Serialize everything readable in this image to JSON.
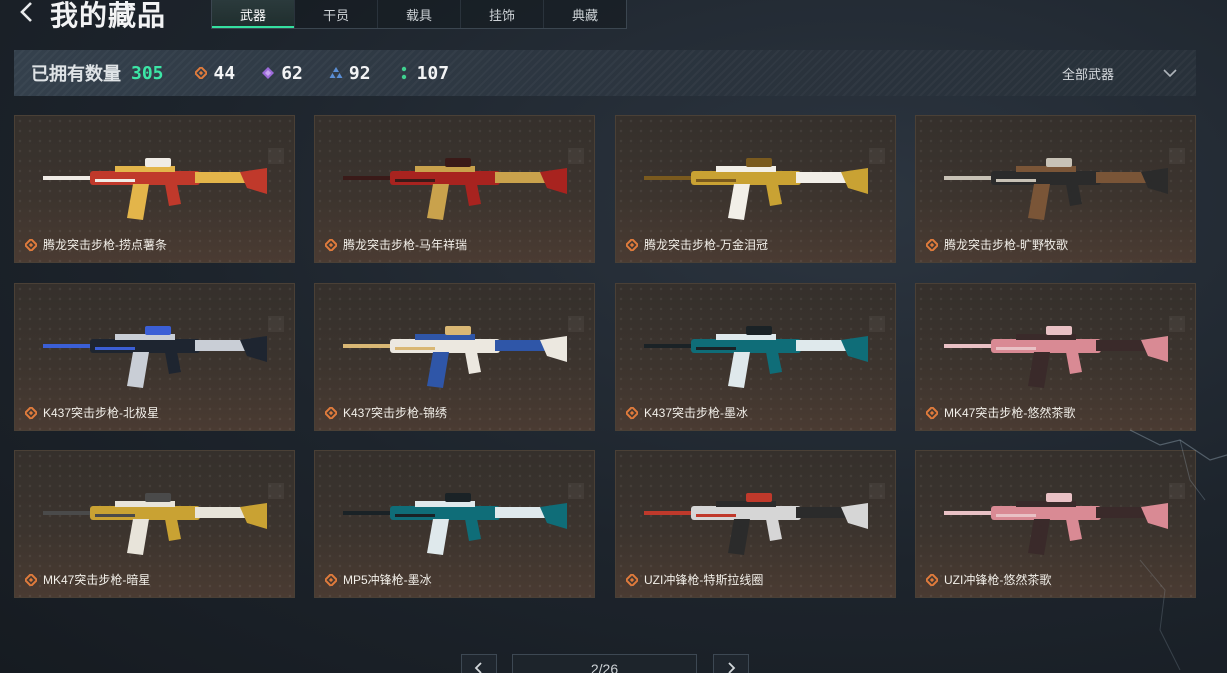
{
  "header": {
    "title": "我的藏品",
    "tabs": [
      {
        "label": "武器",
        "active": true
      },
      {
        "label": "干员",
        "active": false
      },
      {
        "label": "载具",
        "active": false
      },
      {
        "label": "挂饰",
        "active": false
      },
      {
        "label": "典藏",
        "active": false
      }
    ]
  },
  "stats": {
    "owned_label": "已拥有数量",
    "owned_count": "305",
    "rarities": [
      {
        "icon": "orange-diamond-icon",
        "color": "#e07b3c",
        "count": "44"
      },
      {
        "icon": "purple-diamond-icon",
        "color": "#9c6bd9",
        "count": "62"
      },
      {
        "icon": "blue-triangle-icon",
        "color": "#5b8fd6",
        "count": "92"
      },
      {
        "icon": "green-dots-icon",
        "color": "#3fd08f",
        "count": "107"
      }
    ],
    "filter_label": "全部武器"
  },
  "items": [
    {
      "name": "腾龙突击步枪-捞点薯条",
      "palette": [
        "#c0392b",
        "#e3b54a",
        "#f0ece6"
      ]
    },
    {
      "name": "腾龙突击步枪-马年祥瑞",
      "palette": [
        "#a8231f",
        "#c9a24c",
        "#3a1a18"
      ]
    },
    {
      "name": "腾龙突击步枪-万金泪冠",
      "palette": [
        "#c9a233",
        "#f2efe8",
        "#7a5a1e"
      ]
    },
    {
      "name": "腾龙突击步枪-旷野牧歌",
      "palette": [
        "#2b2b2b",
        "#7a5537",
        "#c8c2b6"
      ]
    },
    {
      "name": "K437突击步枪-北极星",
      "palette": [
        "#1e2530",
        "#c9ced6",
        "#3b5fd6"
      ]
    },
    {
      "name": "K437突击步枪-锦绣",
      "palette": [
        "#ece8e0",
        "#2f56a8",
        "#d9b774"
      ]
    },
    {
      "name": "K437突击步枪-墨冰",
      "palette": [
        "#0f6d78",
        "#dfe9ec",
        "#1a2226"
      ]
    },
    {
      "name": "MK47突击步枪-悠然茶歌",
      "palette": [
        "#d98a94",
        "#3a2a2a",
        "#e9c1c5"
      ]
    },
    {
      "name": "MK47突击步枪-暗星",
      "palette": [
        "#c9a233",
        "#e8e4da",
        "#4a4a4a"
      ]
    },
    {
      "name": "MP5冲锋枪-墨冰",
      "palette": [
        "#0f6d78",
        "#dfe9ec",
        "#1a2226"
      ]
    },
    {
      "name": "UZI冲锋枪-特斯拉线圈",
      "palette": [
        "#d6d6d6",
        "#2b2b2b",
        "#c0392b"
      ]
    },
    {
      "name": "UZI冲锋枪-悠然茶歌",
      "palette": [
        "#d98a94",
        "#3a2a2a",
        "#e9c1c5"
      ]
    }
  ],
  "pagination": {
    "indicator": "2/26"
  }
}
